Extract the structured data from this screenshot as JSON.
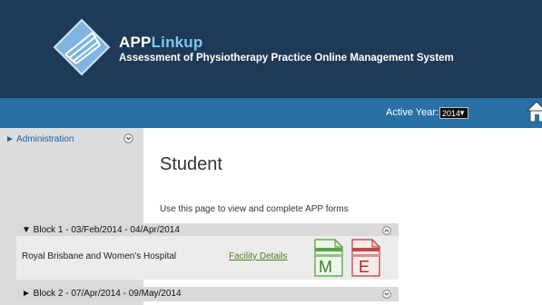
{
  "header": {
    "brand_app": "APP",
    "brand_linkup": "Linkup",
    "tagline": "Assessment of Physiotherapy Practice Online Management System",
    "colors": {
      "header_bg": "#1f3a56",
      "nav_bg": "#2970a6",
      "linkup": "#7fc6f0"
    },
    "logo_icon": "app-linkup-logo-icon"
  },
  "navbar": {
    "year_label": "Active Year:",
    "year_value": "2014",
    "home_icon": "home-icon"
  },
  "sidebar": {
    "items": [
      {
        "label": "► Administration"
      }
    ],
    "collapse_icon": "chevron-down-circle-icon"
  },
  "main": {
    "title": "Student",
    "intro": "Use this page to view and complete APP forms",
    "blocks": [
      {
        "label": "▼ Block 1 - 03/Feb/2014 - 04/Apr/2014",
        "expanded": true,
        "toggle_icon": "chevron-up-circle-icon",
        "hospital": "Royal Brisbane and Women's Hospital",
        "facility_link": "Facility Details",
        "form_icons": [
          "form-m-icon",
          "form-e-icon"
        ]
      },
      {
        "label": "► Block 2 - 07/Apr/2014 - 09/May/2014",
        "expanded": false,
        "toggle_icon": "chevron-down-circle-icon"
      }
    ]
  }
}
